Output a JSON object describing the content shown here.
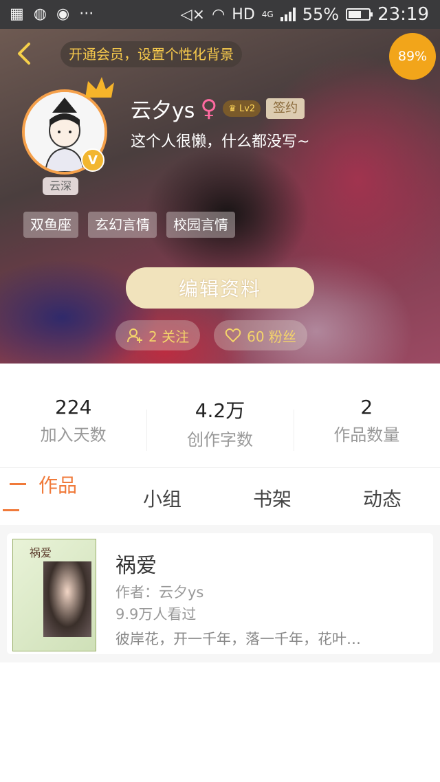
{
  "status_bar": {
    "hd": "HD",
    "network": "4G",
    "battery": "55%",
    "time": "23:19"
  },
  "header": {
    "vip_banner": "开通会员，设置个性化背景",
    "percent_badge": "89%",
    "avatar_name": "云深",
    "user_name": "云夕ys",
    "gender_symbol": "♀",
    "level": "Lv2",
    "sign_tag": "签约",
    "bio": "这个人很懒，什么都没写~",
    "tags": [
      "双鱼座",
      "玄幻言情",
      "校园言情"
    ],
    "edit_button": "编辑资料",
    "follow_label": "2 关注",
    "fans_label": "60 粉丝"
  },
  "stats": [
    {
      "value": "224",
      "label": "加入天数"
    },
    {
      "value": "4.2万",
      "label": "创作字数"
    },
    {
      "value": "2",
      "label": "作品数量"
    }
  ],
  "tabs": [
    "作品",
    "小组",
    "书架",
    "动态"
  ],
  "work": {
    "cover_title": "祸爱",
    "title": "祸爱",
    "author": "作者：云夕ys",
    "views": "9.9万人看过",
    "desc": "彼岸花，开一千年，落一千年，花叶…"
  },
  "colors": {
    "accent": "#f07a3a",
    "gold": "#f6c94c",
    "badge": "#f2a51a"
  }
}
